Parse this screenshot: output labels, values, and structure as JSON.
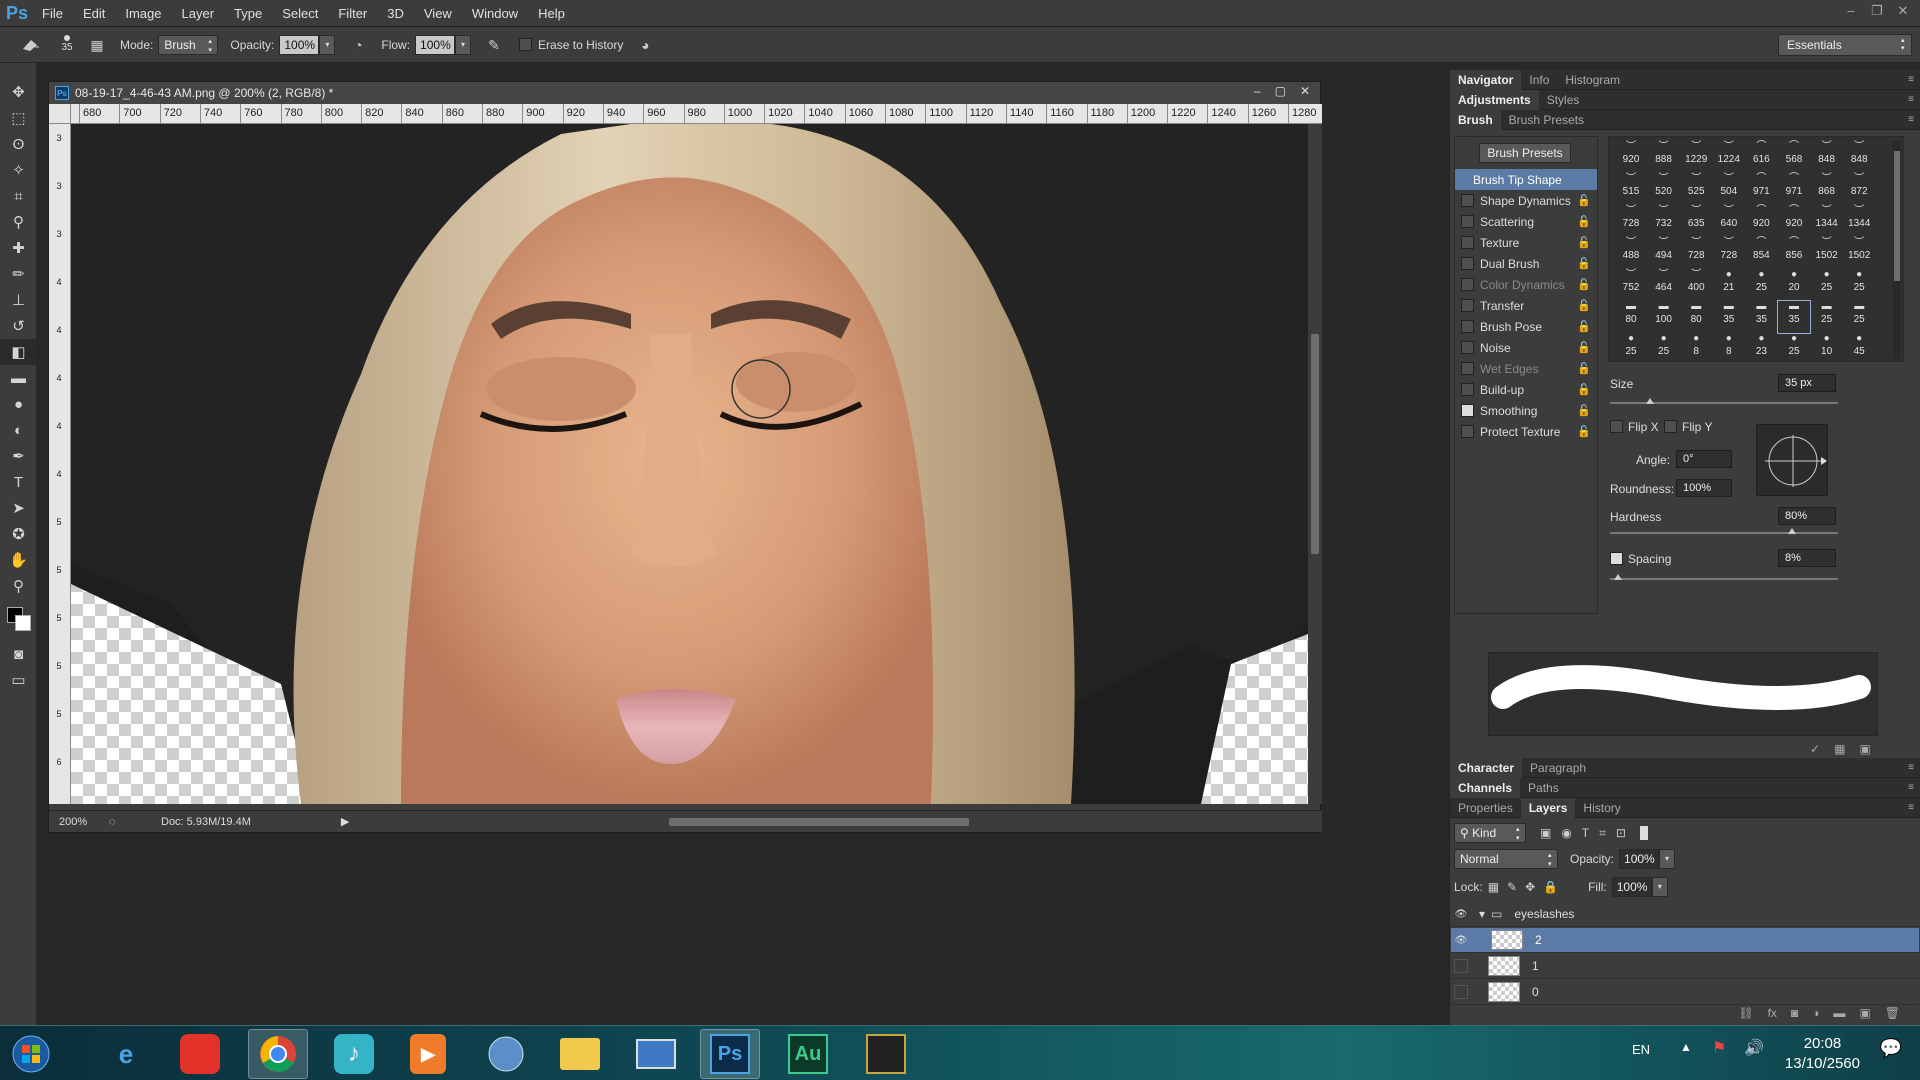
{
  "app": {
    "logo": "Ps"
  },
  "menu": [
    "File",
    "Edit",
    "Image",
    "Layer",
    "Type",
    "Select",
    "Filter",
    "3D",
    "View",
    "Window",
    "Help"
  ],
  "options": {
    "brush_size": "35",
    "mode_label": "Mode:",
    "mode_value": "Brush",
    "opacity_label": "Opacity:",
    "opacity_value": "100%",
    "flow_label": "Flow:",
    "flow_value": "100%",
    "erase_history": "Erase to History",
    "workspace": "Essentials"
  },
  "document": {
    "title": "08-19-17_4-46-43 AM.png @ 200% (2, RGB/8) *",
    "zoom": "200%",
    "doc_info": "Doc: 5.93M/19.4M",
    "ruler_h": [
      "680",
      "700",
      "720",
      "740",
      "760",
      "780",
      "800",
      "820",
      "840",
      "860",
      "880",
      "900",
      "920",
      "940",
      "960",
      "980",
      "1000",
      "1020",
      "1040",
      "1060",
      "1080",
      "1100",
      "1120",
      "1140",
      "1160",
      "1180",
      "1200",
      "1220",
      "1240",
      "1260",
      "1280"
    ],
    "ruler_v": [
      "3",
      "3",
      "3",
      "4",
      "4",
      "4",
      "4",
      "4",
      "5",
      "5",
      "5",
      "5",
      "5",
      "6"
    ]
  },
  "panels": {
    "top_tabs": [
      "Navigator",
      "Info",
      "Histogram"
    ],
    "adj_tabs": [
      "Adjustments",
      "Styles"
    ],
    "brush_tabs": [
      "Brush",
      "Brush Presets"
    ],
    "brush_presets_btn": "Brush Presets",
    "brush_tip_shape": "Brush Tip Shape",
    "brush_options": [
      {
        "label": "Shape Dynamics",
        "checked": false,
        "dim": false
      },
      {
        "label": "Scattering",
        "checked": false,
        "dim": false
      },
      {
        "label": "Texture",
        "checked": false,
        "dim": false
      },
      {
        "label": "Dual Brush",
        "checked": false,
        "dim": false
      },
      {
        "label": "Color Dynamics",
        "checked": false,
        "dim": true
      },
      {
        "label": "Transfer",
        "checked": false,
        "dim": false
      },
      {
        "label": "Brush Pose",
        "checked": false,
        "dim": false
      },
      {
        "label": "Noise",
        "checked": false,
        "dim": false
      },
      {
        "label": "Wet Edges",
        "checked": false,
        "dim": true
      },
      {
        "label": "Build-up",
        "checked": false,
        "dim": false
      },
      {
        "label": "Smoothing",
        "checked": true,
        "dim": false
      },
      {
        "label": "Protect Texture",
        "checked": false,
        "dim": false
      }
    ],
    "brush_grid": [
      [
        "920",
        "888",
        "1229",
        "1224",
        "616",
        "568",
        "848",
        "848"
      ],
      [
        "515",
        "520",
        "525",
        "504",
        "971",
        "971",
        "868",
        "872"
      ],
      [
        "728",
        "732",
        "635",
        "640",
        "920",
        "920",
        "1344",
        "1344"
      ],
      [
        "488",
        "494",
        "728",
        "728",
        "854",
        "856",
        "1502",
        "1502"
      ],
      [
        "752",
        "464",
        "400",
        "21",
        "25",
        "20",
        "25",
        "25"
      ],
      [
        "80",
        "100",
        "80",
        "35",
        "35",
        "35",
        "25",
        "25"
      ],
      [
        "25",
        "25",
        "8",
        "8",
        "23",
        "25",
        "10",
        "45"
      ]
    ],
    "size_label": "Size",
    "size_value": "35 px",
    "flipx": "Flip X",
    "flipy": "Flip Y",
    "angle_label": "Angle:",
    "angle_value": "0°",
    "roundness_label": "Roundness:",
    "roundness_value": "100%",
    "hardness_label": "Hardness",
    "hardness_value": "80%",
    "spacing_label": "Spacing",
    "spacing_value": "8%",
    "char_tabs": [
      "Character",
      "Paragraph"
    ],
    "chan_tabs": [
      "Channels",
      "Paths"
    ],
    "layer_tabs": [
      "Properties",
      "Layers",
      "History"
    ],
    "kind": "Kind",
    "blend": "Normal",
    "opacity_label": "Opacity:",
    "opacity_value": "100%",
    "lock_label": "Lock:",
    "fill_label": "Fill:",
    "fill_value": "100%",
    "layers": [
      {
        "name": "eyeslashes",
        "group": true,
        "visible": true,
        "selected": false
      },
      {
        "name": "2",
        "group": false,
        "visible": true,
        "selected": true
      },
      {
        "name": "1",
        "group": false,
        "visible": false,
        "selected": false
      },
      {
        "name": "0",
        "group": false,
        "visible": false,
        "selected": false
      }
    ]
  },
  "taskbar": {
    "lang": "EN",
    "time": "20:08",
    "date": "13/10/2560",
    "audition": "Au"
  }
}
